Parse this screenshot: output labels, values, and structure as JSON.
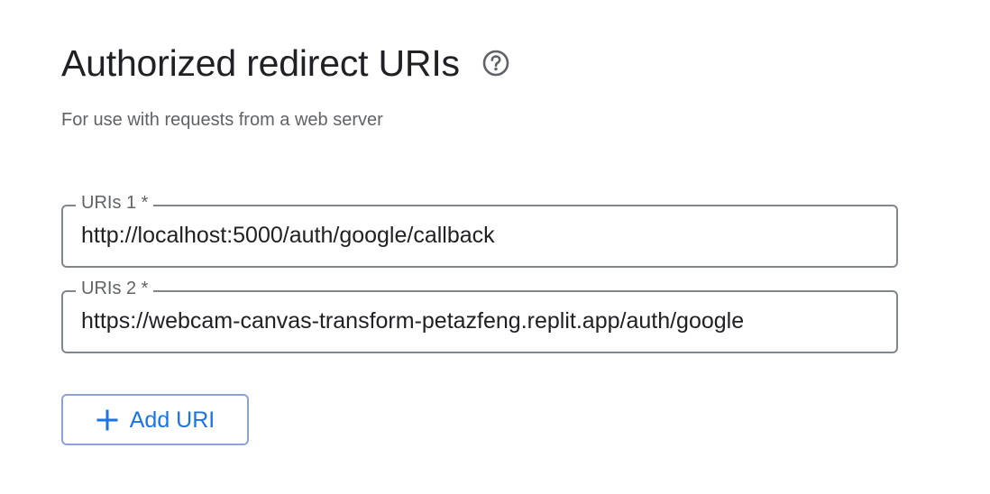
{
  "section": {
    "title": "Authorized redirect URIs",
    "help_icon": "help-circle-icon",
    "subtitle": "For use with requests from a web server"
  },
  "uris": [
    {
      "label": "URIs 1 *",
      "value": "http://localhost:5000/auth/google/callback"
    },
    {
      "label": "URIs 2 *",
      "value": "https://webcam-canvas-transform-petazfeng.replit.app/auth/google"
    }
  ],
  "add_button": {
    "icon": "plus-icon",
    "label": "Add URI"
  },
  "colors": {
    "accent": "#1a73e8",
    "text_primary": "#202124",
    "text_secondary": "#5f6368",
    "outline": "#80868b"
  }
}
